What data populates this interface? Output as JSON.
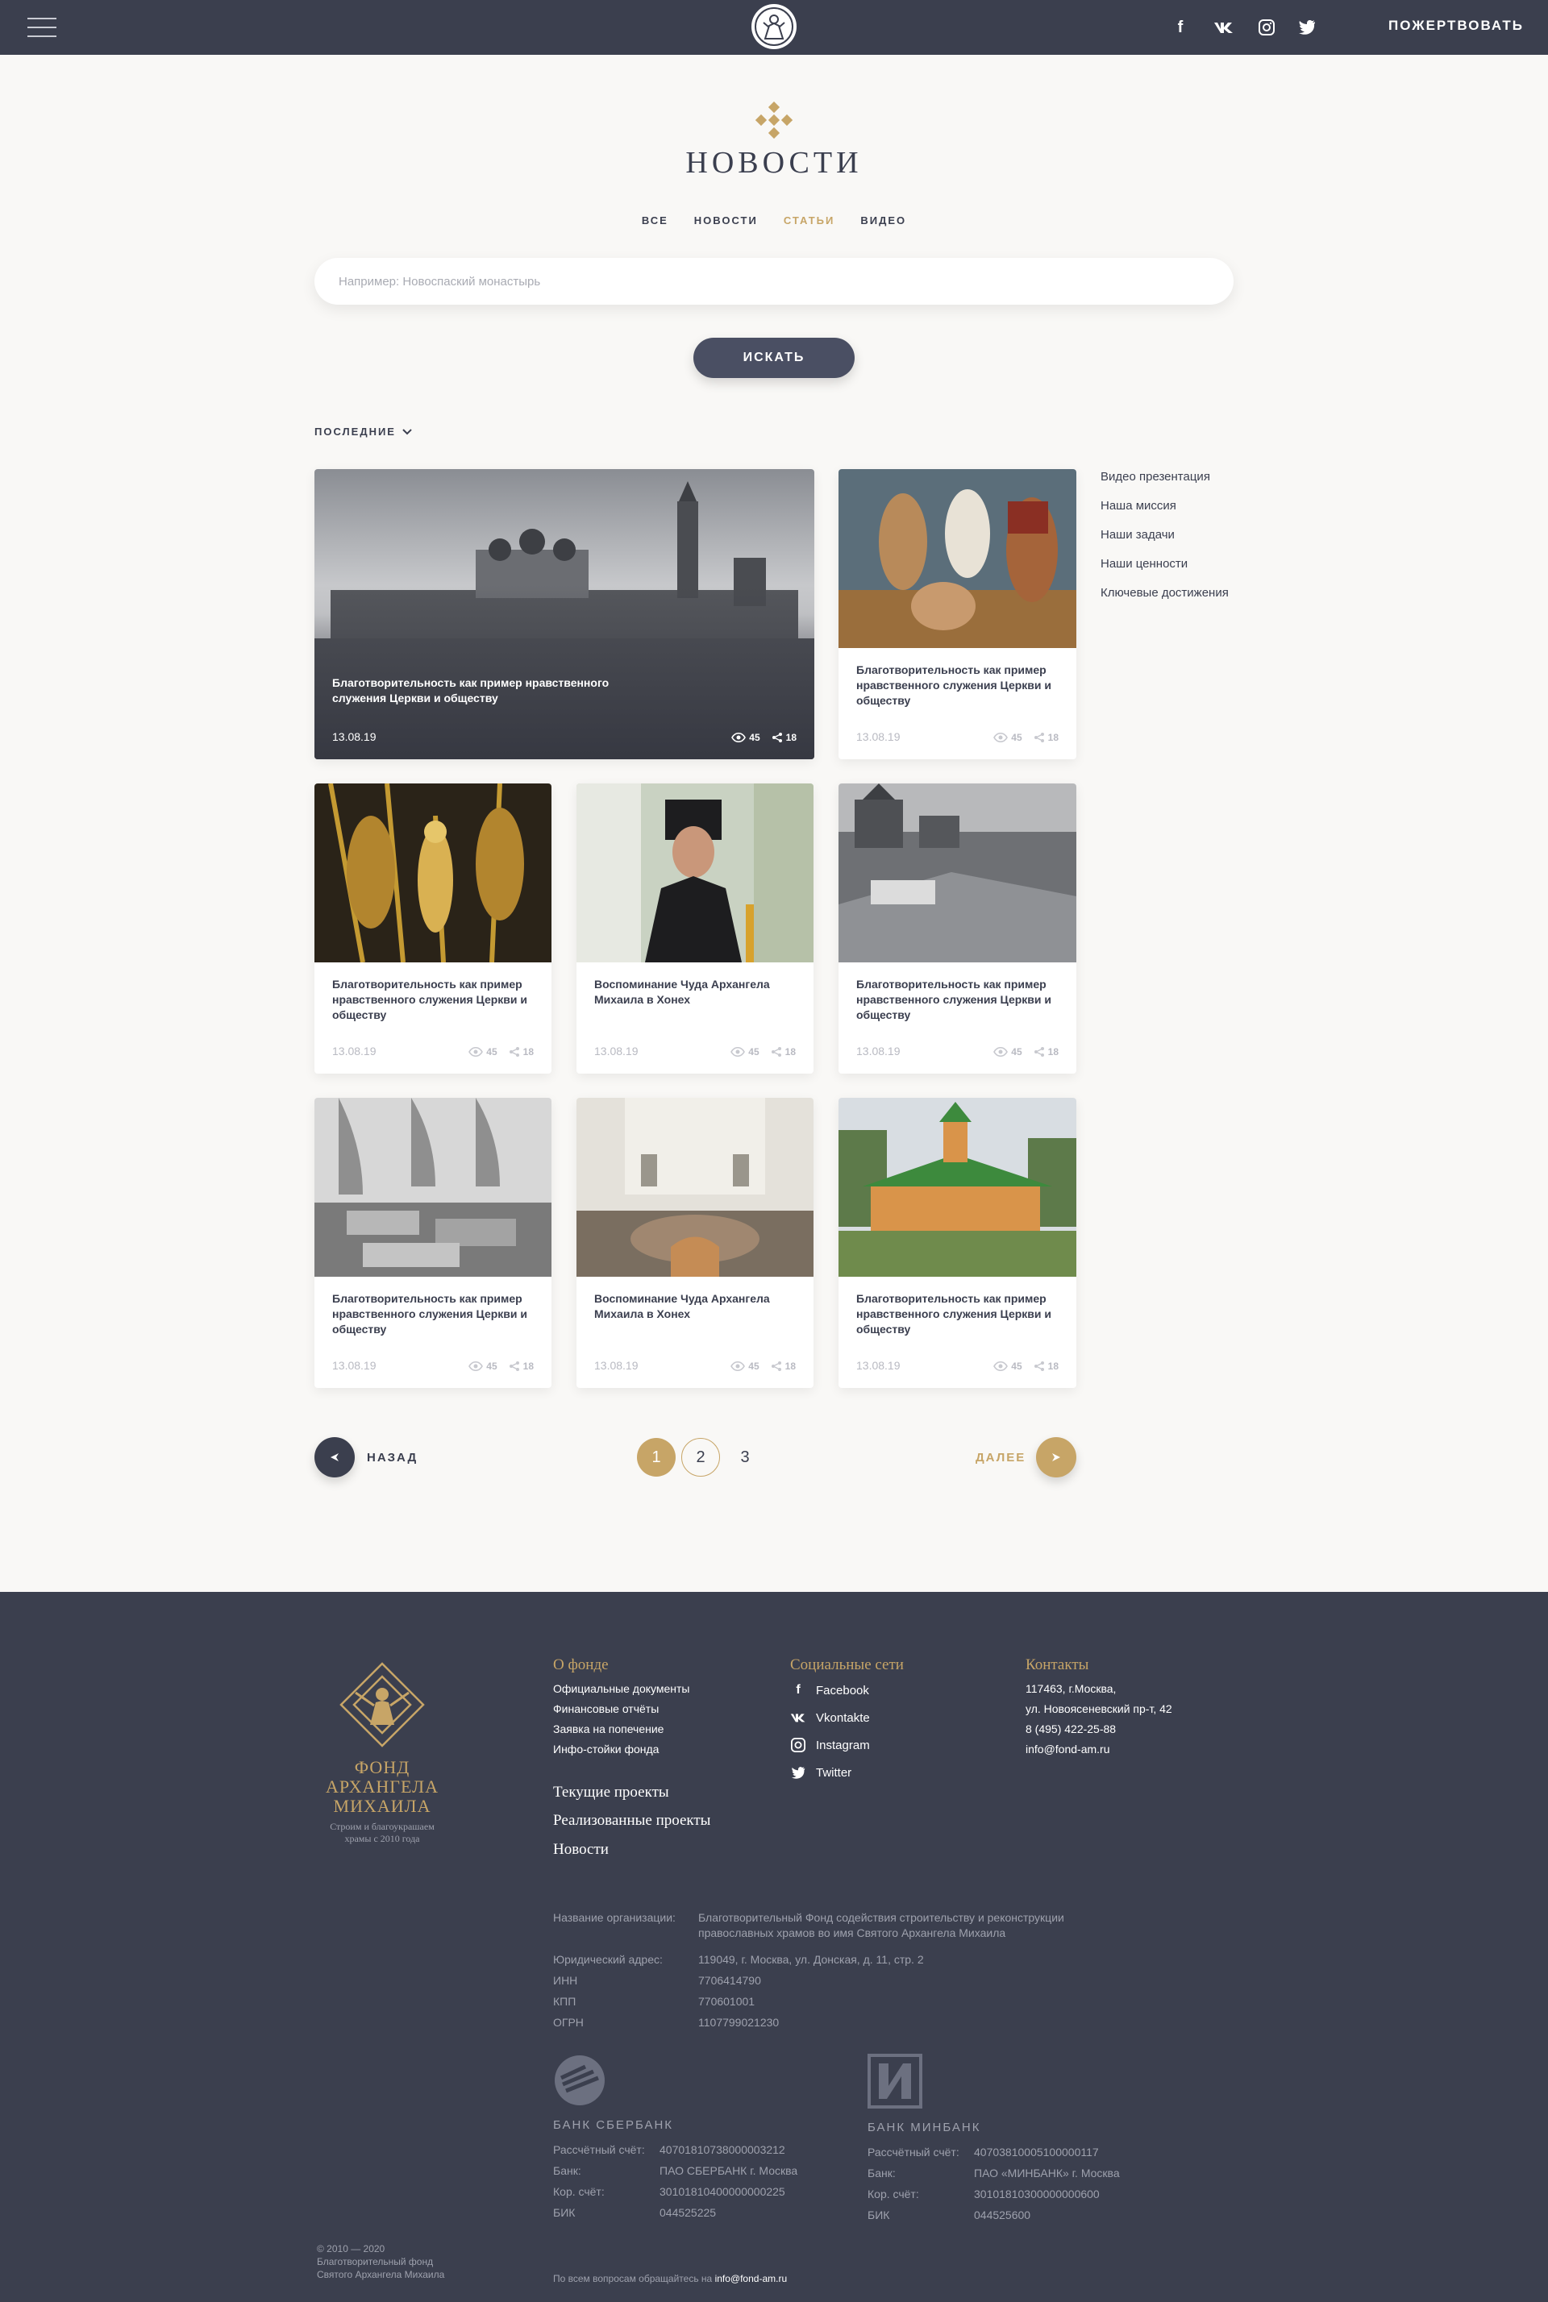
{
  "header": {
    "donate_label": "ПОЖЕРТВОВАТЬ",
    "social_icons": [
      "facebook-icon",
      "vk-icon",
      "instagram-icon",
      "twitter-icon"
    ]
  },
  "page": {
    "title": "НОВОСТИ",
    "tabs": [
      {
        "label": "ВСЕ",
        "active": false
      },
      {
        "label": "НОВОСТИ",
        "active": false
      },
      {
        "label": "СТАТЬИ",
        "active": true
      },
      {
        "label": "ВИДЕО",
        "active": false
      }
    ],
    "search_placeholder": "Например: Новоспаский монастырь",
    "search_button": "ИСКАТЬ",
    "sort_label": "ПОСЛЕДНИЕ"
  },
  "cards": [
    {
      "title": "Благотворительность как пример нравственного служения Церкви и обществу",
      "date": "13.08.19",
      "views": "45",
      "shares": "18"
    },
    {
      "title": "Благотворительность как пример нравственного служения Церкви и обществу",
      "date": "13.08.19",
      "views": "45",
      "shares": "18"
    },
    {
      "title": "Благотворительность как пример нравственного служения Церкви и обществу",
      "date": "13.08.19",
      "views": "45",
      "shares": "18"
    },
    {
      "title": "Воспоминание Чуда Архангела Михаила в Хонех",
      "date": "13.08.19",
      "views": "45",
      "shares": "18"
    },
    {
      "title": "Благотворительность как пример нравственного служения Церкви и обществу",
      "date": "13.08.19",
      "views": "45",
      "shares": "18"
    },
    {
      "title": "Благотворительность как пример нравственного служения Церкви и обществу",
      "date": "13.08.19",
      "views": "45",
      "shares": "18"
    },
    {
      "title": "Воспоминание Чуда Архангела Михаила в Хонех",
      "date": "13.08.19",
      "views": "45",
      "shares": "18"
    },
    {
      "title": "Благотворительность как пример нравственного служения Церкви и обществу",
      "date": "13.08.19",
      "views": "45",
      "shares": "18"
    }
  ],
  "side_links": [
    "Видео презентация",
    "Наша миссия",
    "Наши задачи",
    "Наши ценности",
    "Ключевые достижения"
  ],
  "pagination": {
    "prev_label": "НАЗАД",
    "next_label": "ДАЛЕЕ",
    "pages": [
      "1",
      "2",
      "3"
    ],
    "current": "1"
  },
  "footer": {
    "logo_name": "ФОНД АРХАНГЕЛА МИХАИЛА",
    "logo_sub": "Строим и благоукрашаем храмы с 2010 года",
    "about_head": "О фонде",
    "about_links": [
      "Официальные документы",
      "Финансовые отчёты",
      "Заявка на попечение",
      "Инфо-стойки фонда"
    ],
    "big_links": [
      "Текущие проекты",
      "Реализованные проекты",
      "Новости"
    ],
    "social_head": "Социальные сети",
    "social_links": [
      {
        "icon": "facebook-icon",
        "label": "Facebook"
      },
      {
        "icon": "vk-icon",
        "label": "Vkontakte"
      },
      {
        "icon": "instagram-icon",
        "label": "Instagram"
      },
      {
        "icon": "twitter-icon",
        "label": "Twitter"
      }
    ],
    "contacts_head": "Контакты",
    "contacts": [
      "117463, г.Москва,",
      "ул. Новоясеневский пр-т, 42",
      "8 (495) 422-25-88",
      "info@fond-am.ru"
    ],
    "requisites": [
      {
        "label": "Название организации:",
        "value": "Благотворительный Фонд содействия строительству и реконструкции православных храмов во имя Святого Архангела Михаила"
      },
      {
        "label": "Юридический адрес:",
        "value": "119049, г. Москва, ул. Донская, д. 11, стр. 2"
      },
      {
        "label": "ИНН",
        "value": "7706414790"
      },
      {
        "label": "КПП",
        "value": "770601001"
      },
      {
        "label": "ОГРН",
        "value": "1107799021230"
      }
    ],
    "banks": [
      {
        "name": "БАНК СБЕРБАНК",
        "rows": [
          {
            "label": "Рассчётный счёт:",
            "value": "40701810738000003212"
          },
          {
            "label": "Банк:",
            "value": "ПАО СБЕРБАНК г. Москва"
          },
          {
            "label": "Кор. счёт:",
            "value": "30101810400000000225"
          },
          {
            "label": "БИК",
            "value": "044525225"
          }
        ]
      },
      {
        "name": "БАНК МИНБАНК",
        "rows": [
          {
            "label": "Рассчётный счёт:",
            "value": "40703810005100000117"
          },
          {
            "label": "Банк:",
            "value": "ПАО «МИНБАНК» г. Москва"
          },
          {
            "label": "Кор. счёт:",
            "value": "30101810300000000600"
          },
          {
            "label": "БИК",
            "value": "044525600"
          }
        ]
      }
    ],
    "copyright": [
      "© 2010 — 2020",
      "Благотворительный фонд",
      "Святого Архангела Михаила"
    ],
    "question_text": "По всем вопросам обращайтесь на",
    "question_email": "info@fond-am.ru"
  },
  "colors": {
    "dark": "#3b3f4e",
    "gold": "#c7a567",
    "bg": "#f9f8f6"
  }
}
